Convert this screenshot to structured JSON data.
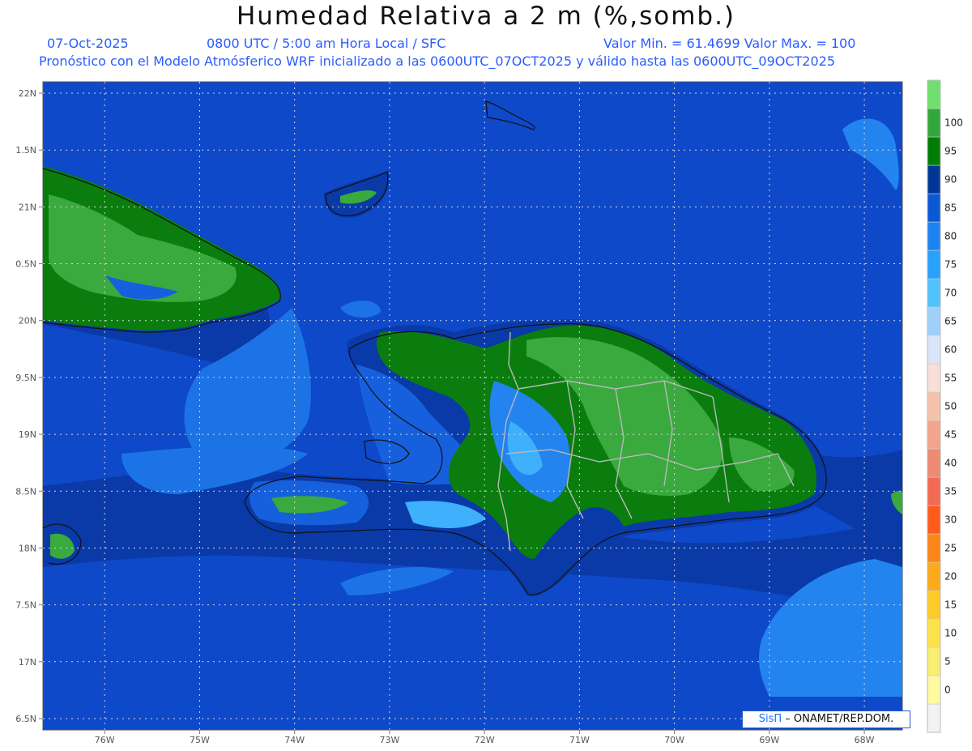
{
  "title": "Humedad Relativa a 2 m (%,somb.)",
  "header": {
    "date": "07-Oct-2025",
    "time": "0800 UTC / 5:00 am Hora Local / SFC",
    "minmax": "Valor Min. = 61.4699  Valor Max. = 100",
    "model": "Pronóstico con el Modelo Atmósferico WRF inicializado a las 0600UTC_07OCT2025 y válido hasta las  0600UTC_09OCT2025"
  },
  "credit": {
    "brand": "SisΠ",
    "text": " – ONAMET/REP.DOM."
  },
  "map": {
    "lon_range": [
      -76.65,
      -67.6
    ],
    "lat_range": [
      16.4,
      22.1
    ],
    "lon_ticks": [
      "76W",
      "75W",
      "74W",
      "73W",
      "72W",
      "71W",
      "70W",
      "69W",
      "68W"
    ],
    "lat_ticks": [
      "22N",
      "1.5N",
      "21N",
      "0.5N",
      "20N",
      "9.5N",
      "19N",
      "8.5N",
      "18N",
      "7.5N",
      "17N",
      "6.5N"
    ]
  },
  "legend": {
    "levels": [
      "0",
      "5",
      "10",
      "15",
      "20",
      "25",
      "30",
      "35",
      "40",
      "45",
      "50",
      "55",
      "60",
      "65",
      "70",
      "75",
      "80",
      "85",
      "90",
      "95",
      "100"
    ],
    "colors": [
      "#f2f2f2",
      "#fffaa0",
      "#f8ee72",
      "#fce34a",
      "#fdcb28",
      "#fdaa1a",
      "#fd8716",
      "#fe5b1a",
      "#f36a52",
      "#ec8a74",
      "#f2a58c",
      "#f7c2ab",
      "#f9dfd8",
      "#dbe4f8",
      "#9ed0fa",
      "#4fc3fe",
      "#28a1fd",
      "#1d82f2",
      "#0b58d4",
      "#003796",
      "#007d06",
      "#32a83b",
      "#6fe06d"
    ]
  },
  "colors": {
    "ocean": "#0e49c9",
    "hum_85": "#0a3aa8",
    "hum_80": "#1660dd",
    "hum_75": "#2384f0",
    "hum_70": "#3fb0fb",
    "land_90": "#0a7d0e",
    "land_95": "#3aa93e",
    "border": "#b8b8b8"
  }
}
